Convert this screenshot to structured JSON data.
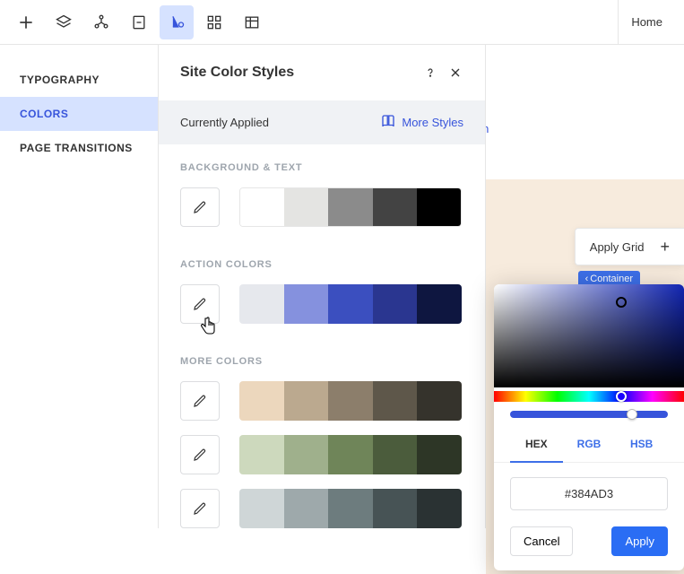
{
  "toolbar": {
    "home": "Home"
  },
  "sidebar": {
    "items": [
      {
        "label": "TYPOGRAPHY"
      },
      {
        "label": "COLORS"
      },
      {
        "label": "PAGE TRANSITIONS"
      }
    ]
  },
  "panel": {
    "title": "Site Color Styles",
    "applied": "Currently Applied",
    "more_styles": "More Styles",
    "sections": {
      "bg_text": "BACKGROUND & TEXT",
      "action": "ACTION COLORS",
      "more": "MORE COLORS"
    },
    "palettes": {
      "bg_text": [
        "#ffffff",
        "#e4e4e2",
        "#8b8b8b",
        "#434343",
        "#000000"
      ],
      "action": [
        "#e6e8ed",
        "#8591de",
        "#3b4fbf",
        "#2a3690",
        "#0e1640"
      ],
      "more1": [
        "#ecd7bd",
        "#bba98f",
        "#8c7e6b",
        "#5e574a",
        "#35332c"
      ],
      "more2": [
        "#cdd9bd",
        "#9fb08c",
        "#6f8559",
        "#4b5c3c",
        "#2d3626"
      ],
      "more3": [
        "#cfd6d7",
        "#9ea9ab",
        "#6d7c7e",
        "#475355",
        "#2a3233"
      ]
    }
  },
  "canvas": {
    "apply_grid": "Apply Grid",
    "container_badge": "Container",
    "domain_fragment": "omain"
  },
  "picker": {
    "tabs": [
      "HEX",
      "RGB",
      "HSB"
    ],
    "hex_value": "#384AD3",
    "cancel": "Cancel",
    "apply": "Apply"
  }
}
